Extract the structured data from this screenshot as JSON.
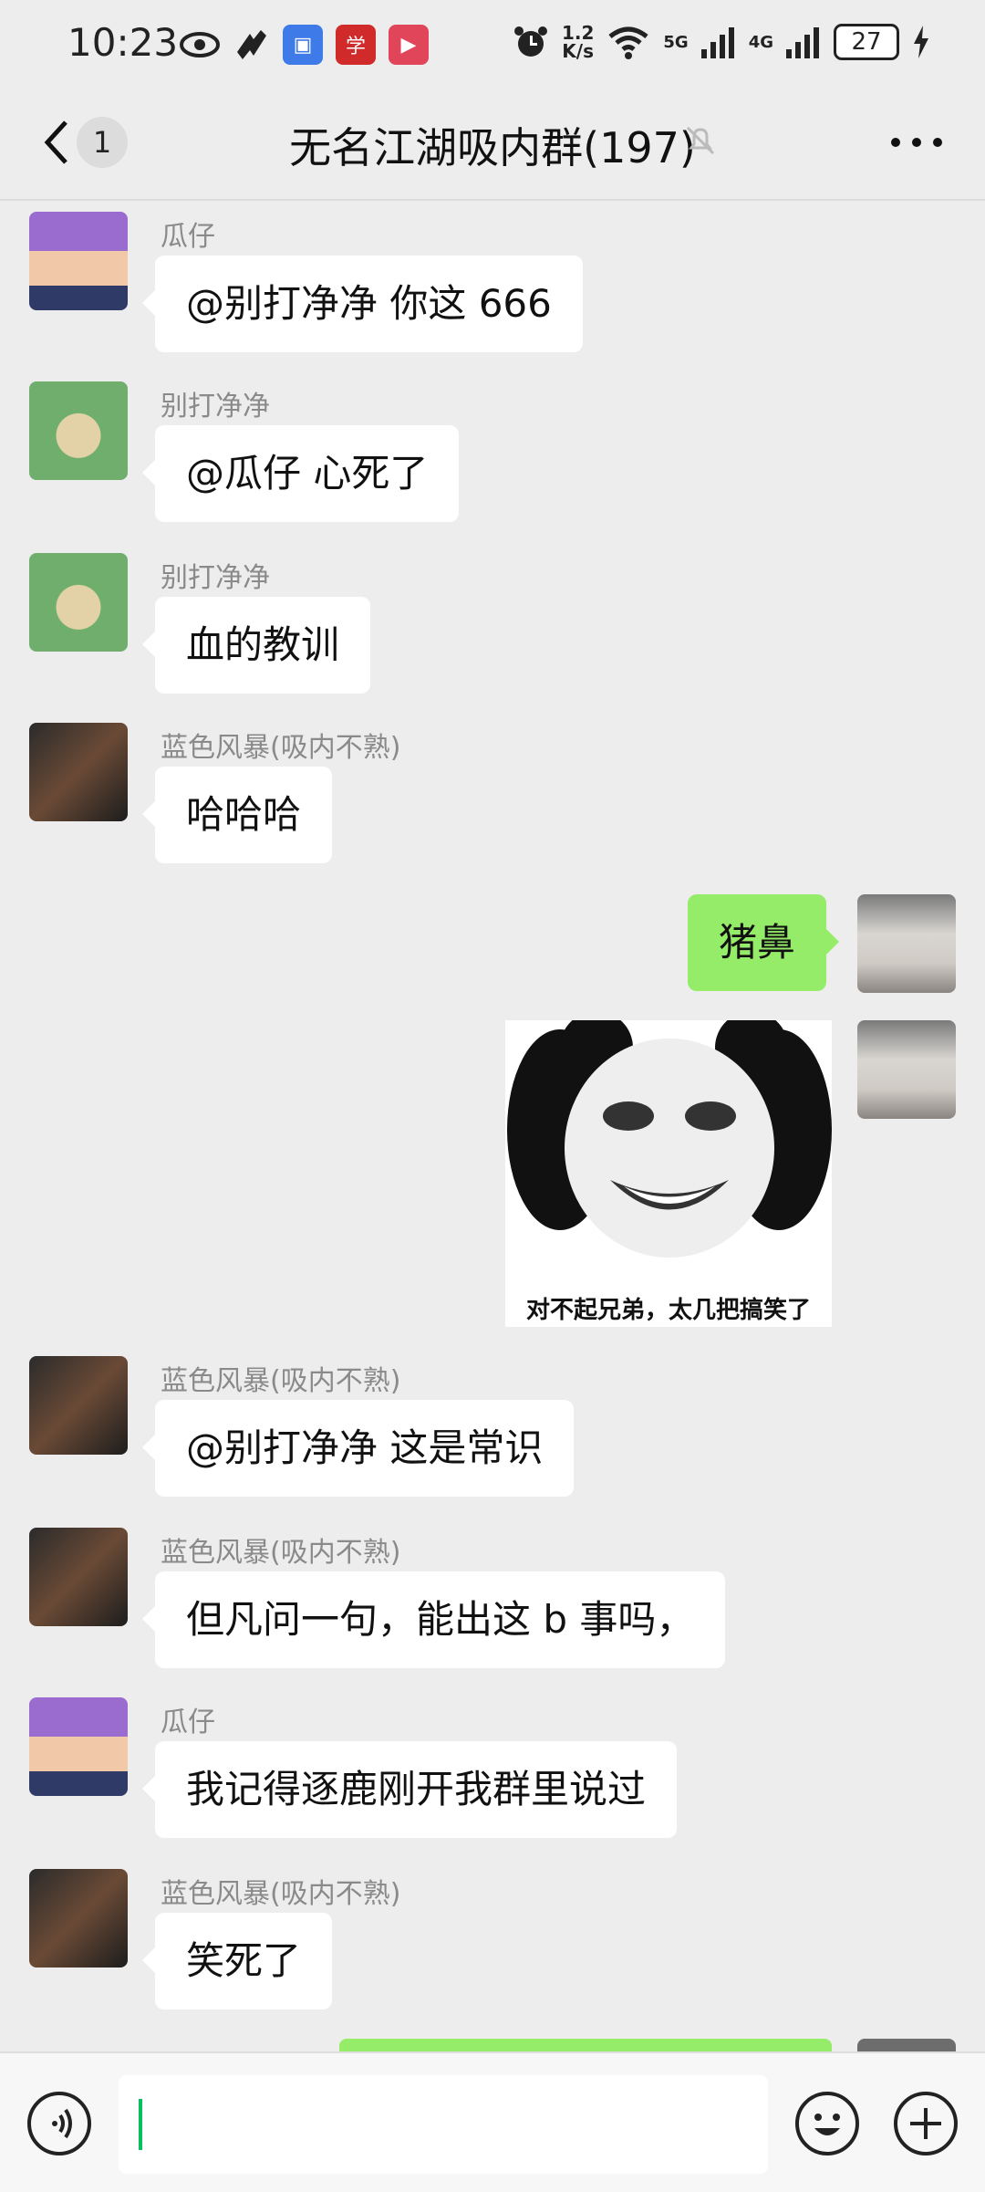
{
  "status_bar": {
    "time": "10:23",
    "net_speed_value": "1.2",
    "net_speed_unit": "K/s",
    "signal_5g": "5G",
    "signal_4g": "4G",
    "battery": "27"
  },
  "header": {
    "unread_count": "1",
    "title": "无名江湖吸内群(197)"
  },
  "messages": [
    {
      "sender": "瓜仔",
      "text": "@别打净净  你这 666"
    },
    {
      "sender": "别打净净",
      "text": "@瓜仔  心死了"
    },
    {
      "sender": "别打净净",
      "text": "血的教训"
    },
    {
      "sender": "蓝色风暴(吸内不熟)",
      "text": "哈哈哈"
    },
    {
      "sender": "",
      "text": "猪鼻"
    },
    {
      "sender": "",
      "text": "对不起兄弟，太几把搞笑了"
    },
    {
      "sender": "蓝色风暴(吸内不熟)",
      "text": "@别打净净  这是常识"
    },
    {
      "sender": "蓝色风暴(吸内不熟)",
      "text": "但凡问一句，能出这 b 事吗，"
    },
    {
      "sender": "瓜仔",
      "text": "我记得逐鹿刚开我群里说过"
    },
    {
      "sender": "蓝色风暴(吸内不熟)",
      "text": "笑死了"
    }
  ],
  "colors": {
    "background": "#ededed",
    "self_bubble": "#95ec69",
    "other_bubble": "#ffffff",
    "cursor": "#07c160"
  }
}
